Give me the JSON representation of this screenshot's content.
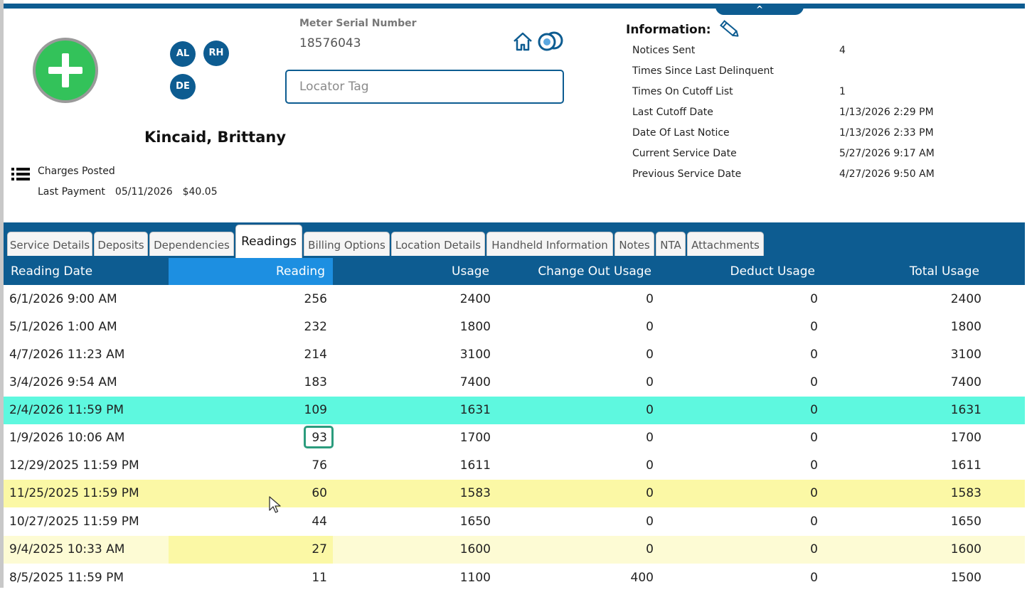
{
  "header": {
    "collapse_glyph": "^"
  },
  "customer": {
    "add_button_icon": "plus-circle-icon",
    "avatars": [
      "AL",
      "RH",
      "DE"
    ],
    "name": "Kincaid, Brittany",
    "charges_label": "Charges Posted",
    "last_payment_label": "Last Payment",
    "last_payment_date": "05/11/2026",
    "last_payment_amount": "$40.05"
  },
  "meter": {
    "serial_label": "Meter Serial Number",
    "serial_value": "18576043",
    "locator_placeholder": "Locator Tag"
  },
  "information": {
    "title": "Information:",
    "rows": [
      {
        "label": "Notices Sent",
        "value": "4"
      },
      {
        "label": "Times Since Last Delinquent",
        "value": ""
      },
      {
        "label": "Times On Cutoff List",
        "value": "1"
      },
      {
        "label": "Last Cutoff Date",
        "value": "1/13/2026 2:29 PM"
      },
      {
        "label": "Date Of Last Notice",
        "value": "1/13/2026 2:33 PM"
      },
      {
        "label": "Current Service Date",
        "value": "5/27/2026 9:17 AM"
      },
      {
        "label": "Previous Service Date",
        "value": "4/27/2026 9:50 AM"
      }
    ]
  },
  "tabs": [
    {
      "label": "Service Details",
      "active": false
    },
    {
      "label": "Deposits",
      "active": false
    },
    {
      "label": "Dependencies",
      "active": false
    },
    {
      "label": "Readings",
      "active": true
    },
    {
      "label": "Billing Options",
      "active": false
    },
    {
      "label": "Location Details",
      "active": false
    },
    {
      "label": "Handheld Information",
      "active": false
    },
    {
      "label": "Notes",
      "active": false
    },
    {
      "label": "NTA",
      "active": false
    },
    {
      "label": "Attachments",
      "active": false
    }
  ],
  "grid": {
    "columns": [
      "Reading Date",
      "Reading",
      "Usage",
      "Change Out Usage",
      "Deduct Usage",
      "Total Usage"
    ],
    "rows": [
      {
        "date": "6/1/2026 9:00 AM",
        "reading": "256",
        "usage": "2400",
        "change_out": "0",
        "deduct": "0",
        "total": "2400",
        "highlight": "none"
      },
      {
        "date": "5/1/2026 1:00 AM",
        "reading": "232",
        "usage": "1800",
        "change_out": "0",
        "deduct": "0",
        "total": "1800",
        "highlight": "none"
      },
      {
        "date": "4/7/2026 11:23 AM",
        "reading": "214",
        "usage": "3100",
        "change_out": "0",
        "deduct": "0",
        "total": "3100",
        "highlight": "none"
      },
      {
        "date": "3/4/2026 9:54 AM",
        "reading": "183",
        "usage": "7400",
        "change_out": "0",
        "deduct": "0",
        "total": "7400",
        "highlight": "none"
      },
      {
        "date": "2/4/2026 11:59 PM",
        "reading": "109",
        "usage": "1631",
        "change_out": "0",
        "deduct": "0",
        "total": "1631",
        "highlight": "green"
      },
      {
        "date": "1/9/2026 10:06 AM",
        "reading": "93",
        "usage": "1700",
        "change_out": "0",
        "deduct": "0",
        "total": "1700",
        "highlight": "none"
      },
      {
        "date": "12/29/2025 11:59 PM",
        "reading": "76",
        "usage": "1611",
        "change_out": "0",
        "deduct": "0",
        "total": "1611",
        "highlight": "none"
      },
      {
        "date": "11/25/2025 11:59 PM",
        "reading": "60",
        "usage": "1583",
        "change_out": "0",
        "deduct": "0",
        "total": "1583",
        "highlight": "yellow"
      },
      {
        "date": "10/27/2025 11:59 PM",
        "reading": "44",
        "usage": "1650",
        "change_out": "0",
        "deduct": "0",
        "total": "1650",
        "highlight": "none"
      },
      {
        "date": "9/4/2025 10:33 AM",
        "reading": "27",
        "usage": "1600",
        "change_out": "0",
        "deduct": "0",
        "total": "1600",
        "highlight": "lightyellow"
      },
      {
        "date": "8/5/2025 11:59 PM",
        "reading": "11",
        "usage": "1100",
        "change_out": "400",
        "deduct": "0",
        "total": "1500",
        "highlight": "none"
      }
    ]
  },
  "colors": {
    "brand_blue": "#0d5c91",
    "header_highlight": "#1d8fe1",
    "row_green": "#5ef8df",
    "row_yellow": "#fbf8a5",
    "row_lightyellow": "#fdfbd4",
    "add_green": "#33c25a"
  }
}
